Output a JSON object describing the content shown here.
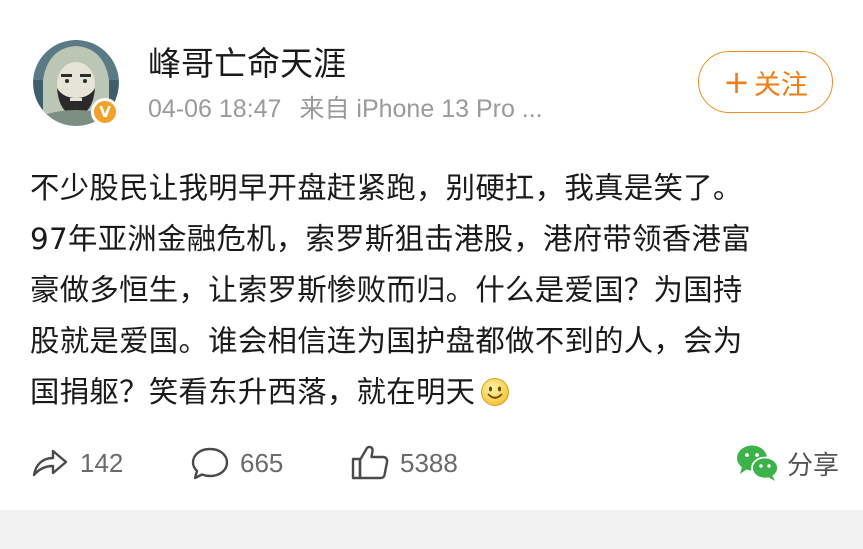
{
  "post": {
    "username": "峰哥亡命天涯",
    "date": "04-06 18:47",
    "source": "来自 iPhone 13 Pro ...",
    "verified_mark": "V",
    "follow_label": "关注",
    "follow_plus": "+",
    "content_lines": [
      "不少股民让我明早开盘赶紧跑，别硬扛，我真是笑了。",
      "97年亚洲金融危机，索罗斯狙击港股，港府带领香港富",
      "豪做多恒生，让索罗斯惨败而归。什么是爱国？为国持",
      "股就是爱国。谁会相信连为国护盘都做不到的人，会为",
      "国捐躯？笑看东升西落，就在明天"
    ],
    "emoji": "smile-emoji"
  },
  "actions": {
    "repost_count": "142",
    "comment_count": "665",
    "like_count": "5388",
    "share_label": "分享"
  },
  "colors": {
    "accent_orange": "#f07d16",
    "wechat_green": "#3bb24a",
    "meta_gray": "#9a9a9a"
  },
  "icons": [
    "repost-icon",
    "comment-icon",
    "like-icon",
    "wechat-icon",
    "verified-icon",
    "smile-emoji-icon"
  ]
}
